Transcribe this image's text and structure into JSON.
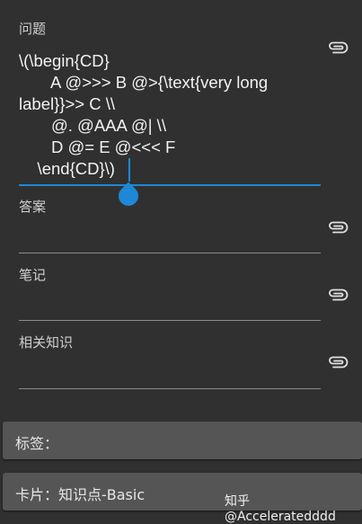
{
  "fields": [
    {
      "label": "问题"
    },
    {
      "label": "答案"
    },
    {
      "label": "笔记"
    },
    {
      "label": "相关知识"
    }
  ],
  "question_text": "\\(\\begin{CD}\n       A @>>> B @>{\\text{very long\nlabel}}>> C \\\\\n       @. @AAA @| \\\\\n       D @= E @<<< F\n    \\end{CD}\\)",
  "tags_label": "标签：",
  "card_label": "卡片：知识点-Basic",
  "watermark": "知乎 @Acceleratedddd",
  "icons": {
    "attach": "paperclip-icon"
  },
  "colors": {
    "background": "#303030",
    "accent": "#1e88d6",
    "bar": "#555555"
  }
}
